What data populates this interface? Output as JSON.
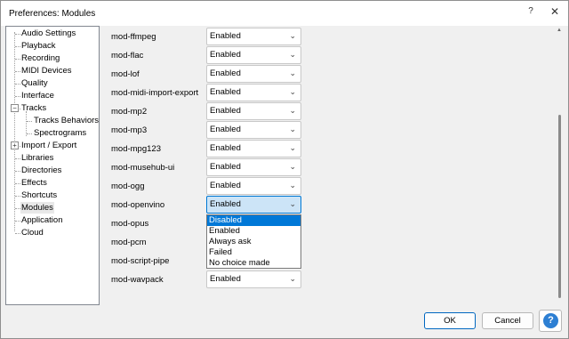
{
  "window": {
    "title": "Preferences: Modules",
    "help_glyph": "?",
    "close_glyph": "✕"
  },
  "tree": {
    "items": [
      {
        "label": "Audio Settings"
      },
      {
        "label": "Playback"
      },
      {
        "label": "Recording"
      },
      {
        "label": "MIDI Devices"
      },
      {
        "label": "Quality"
      },
      {
        "label": "Interface"
      },
      {
        "label": "Tracks"
      },
      {
        "label": "Tracks Behaviors"
      },
      {
        "label": "Spectrograms"
      },
      {
        "label": "Import / Export"
      },
      {
        "label": "Libraries"
      },
      {
        "label": "Directories"
      },
      {
        "label": "Effects"
      },
      {
        "label": "Shortcuts"
      },
      {
        "label": "Modules"
      },
      {
        "label": "Application"
      },
      {
        "label": "Cloud"
      }
    ],
    "selected": "Modules",
    "expander_minus": "−",
    "expander_plus": "+"
  },
  "modules": [
    {
      "name": "mod-ffmpeg",
      "value": "Enabled"
    },
    {
      "name": "mod-flac",
      "value": "Enabled"
    },
    {
      "name": "mod-lof",
      "value": "Enabled"
    },
    {
      "name": "mod-midi-import-export",
      "value": "Enabled"
    },
    {
      "name": "mod-mp2",
      "value": "Enabled"
    },
    {
      "name": "mod-mp3",
      "value": "Enabled"
    },
    {
      "name": "mod-mpg123",
      "value": "Enabled"
    },
    {
      "name": "mod-musehub-ui",
      "value": "Enabled"
    },
    {
      "name": "mod-ogg",
      "value": "Enabled"
    },
    {
      "name": "mod-openvino",
      "value": "Enabled"
    },
    {
      "name": "mod-opus",
      "value": ""
    },
    {
      "name": "mod-pcm",
      "value": ""
    },
    {
      "name": "mod-script-pipe",
      "value": ""
    },
    {
      "name": "mod-wavpack",
      "value": "Enabled"
    }
  ],
  "dropdown": {
    "options": [
      "Disabled",
      "Enabled",
      "Always ask",
      "Failed",
      "No choice made"
    ],
    "highlighted": "Disabled"
  },
  "chevron": "⌄",
  "buttons": {
    "ok": "OK",
    "cancel": "Cancel",
    "help": "?"
  },
  "colors": {
    "accent": "#0078d7",
    "help_icon": "#2d7fd3"
  }
}
